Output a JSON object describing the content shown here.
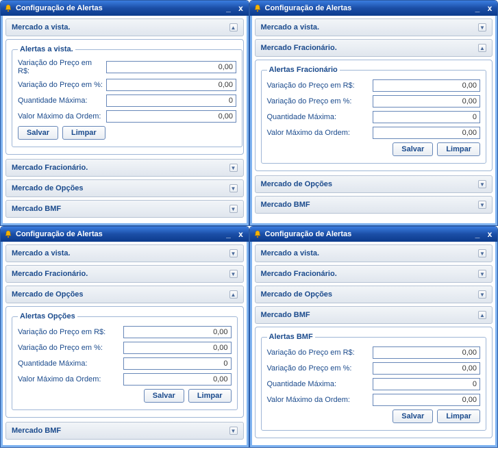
{
  "window_title": "Configuração de Alertas",
  "sections": {
    "vista": "Mercado a vista.",
    "fracionario": "Mercado Fracionário.",
    "opcoes": "Mercado de Opções",
    "bmf": "Mercado BMF"
  },
  "legends": {
    "vista": "Alertas a vista.",
    "fracionario": "Alertas Fracionário",
    "opcoes": "Alertas Opções",
    "bmf": "Alertas BMF"
  },
  "fields": {
    "var_rs": "Variação do Preço em R$:",
    "var_pct": "Variação do Preço em %:",
    "qtd_max": "Quantidade Máxima:",
    "val_max": "Valor Máximo da Ordem:"
  },
  "values": {
    "vista": {
      "var_rs": "0,00",
      "var_pct": "0,00",
      "qtd_max": "0",
      "val_max": "0,00"
    },
    "fracionario": {
      "var_rs": "0,00",
      "var_pct": "0,00",
      "qtd_max": "0",
      "val_max": "0,00"
    },
    "opcoes": {
      "var_rs": "0,00",
      "var_pct": "0,00",
      "qtd_max": "0",
      "val_max": "0,00"
    },
    "bmf": {
      "var_rs": "0,00",
      "var_pct": "0,00",
      "qtd_max": "0",
      "val_max": "0,00"
    }
  },
  "buttons": {
    "save": "Salvar",
    "clear": "Limpar"
  },
  "glyphs": {
    "min": "_",
    "close": "x",
    "up": "▲",
    "down": "▼"
  }
}
